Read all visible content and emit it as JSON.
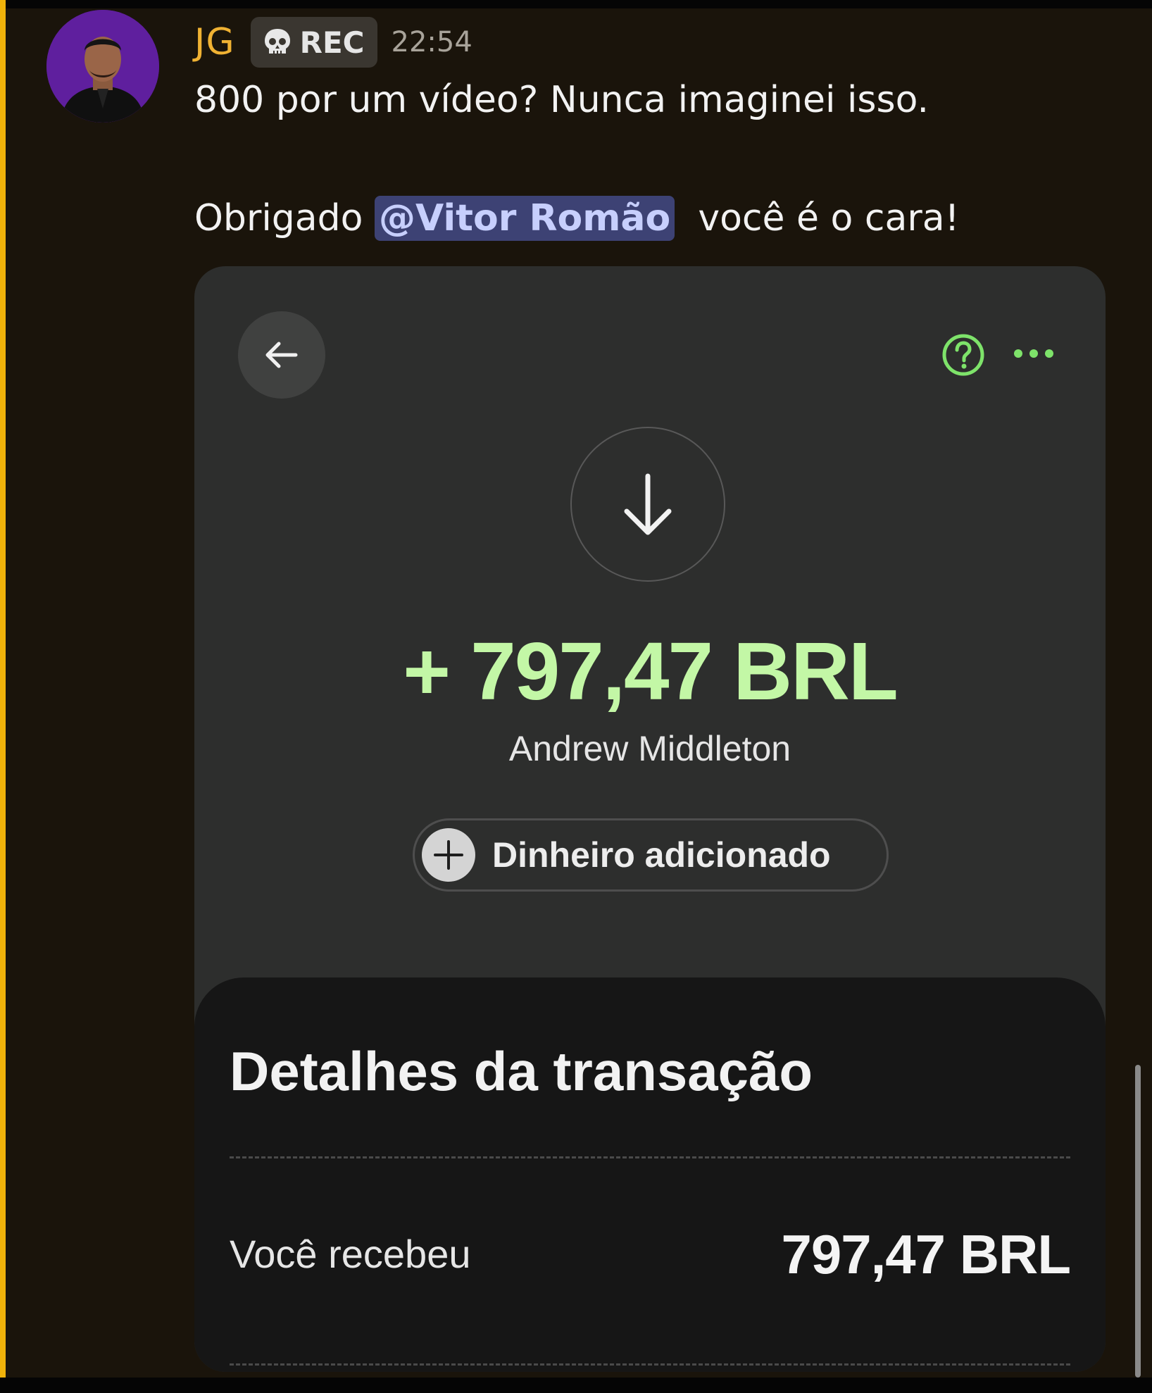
{
  "message": {
    "username": "JG",
    "tag_label": "REC",
    "timestamp": "22:54",
    "line1": "800 por um vídeo? Nunca imaginei isso.",
    "line2_prefix": "Obrigado ",
    "mention": "@Vitor Romão",
    "line2_suffix": "você é o cara!"
  },
  "transaction": {
    "amount": "+ 797,47 BRL",
    "sender": "Andrew Middleton",
    "status": "Dinheiro adicionado",
    "details_title": "Detalhes da transação",
    "received_label": "Você recebeu",
    "received_value": "797,47 BRL"
  },
  "icons": {
    "skull": "skull-icon",
    "back": "arrow-left-icon",
    "help": "help-circle-icon",
    "more": "more-dots-icon",
    "download": "arrow-down-icon",
    "plus": "plus-icon"
  },
  "colors": {
    "accent_yellow": "#f0b233",
    "mention_bg": "#3d4274",
    "amount_green": "#c3f7a6",
    "icon_green": "#7ee36a"
  }
}
